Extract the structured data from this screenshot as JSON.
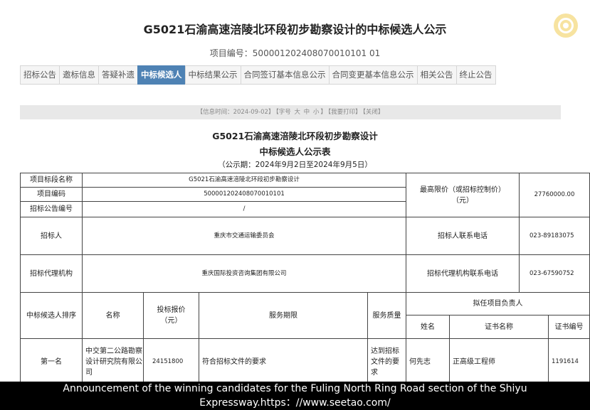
{
  "page": {
    "title": "G5021石渝高速涪陵北环段初步勘察设计的中标候选人公示",
    "project_no_label": "项目编号：",
    "project_no": "500001202408070010101 01"
  },
  "tabs": [
    {
      "label": "招标公告",
      "active": false
    },
    {
      "label": "邀标信息",
      "active": false
    },
    {
      "label": "答疑补遗",
      "active": false
    },
    {
      "label": "中标候选人",
      "active": true
    },
    {
      "label": "中标结果公示",
      "active": false
    },
    {
      "label": "合同签订基本信息公示",
      "active": false
    },
    {
      "label": "合同变更基本信息公示",
      "active": false
    },
    {
      "label": "相关公告",
      "active": false
    },
    {
      "label": "终止公告",
      "active": false
    }
  ],
  "info_bar": {
    "date": "【信息时间：2024-09-02】",
    "font_prefix": "【字号",
    "font_large": "大",
    "font_medium": "中",
    "font_small": "小",
    "font_suffix": "】",
    "print": "【我要打印】",
    "close": "【关闭】"
  },
  "document": {
    "title_line1": "G5021石渝高速涪陵北环段初步勘察设计",
    "title_line2": "中标候选人公示表",
    "period": "（公示期：2024年9月2日至2024年9月5日）"
  },
  "table": {
    "section_name_label": "项目标段名称",
    "section_name": "G5021石渝高速涪陵北环段初步勘察设计",
    "project_code_label": "项目编码",
    "project_code": "500001202408070010101",
    "notice_no_label": "招标公告编号",
    "notice_no": "/",
    "max_price_label": "最高限价（或招标控制价）（元）",
    "max_price": "27760000.00",
    "tenderer_label": "招标人",
    "tenderer": "重庆市交通运输委员会",
    "tenderer_phone_label": "招标人联系电话",
    "tenderer_phone": "023-89183075",
    "agency_label": "招标代理机构",
    "agency": "重庆国际投资咨询集团有限公司",
    "agency_phone_label": "招标代理机构联系电话",
    "agency_phone": "023-67590752",
    "headers": {
      "rank": "中标候选人排序",
      "name": "名称",
      "bid_price": "投标报价（元）",
      "service_period": "服务期限",
      "service_quality": "服务质量",
      "leader_group": "拟任项目负责人",
      "leader_name": "姓名",
      "cert_name": "证书名称",
      "cert_no": "证书编号"
    },
    "rows": [
      {
        "rank": "第一名",
        "name": "中交第二公路勘察设计研究院有限公司",
        "bid_price": "24151800",
        "service_period": "符合招标文件的要求",
        "service_quality": "达到招标文件的要求",
        "leader_name": "何先志",
        "cert_name": "正高级工程师",
        "cert_no": "1191614"
      }
    ]
  },
  "caption": {
    "line1": "Announcement of the winning candidates for the Fuling North Ring Road section of the Shiyu",
    "line2": "Expressway.https：//www.seetao.com/"
  }
}
